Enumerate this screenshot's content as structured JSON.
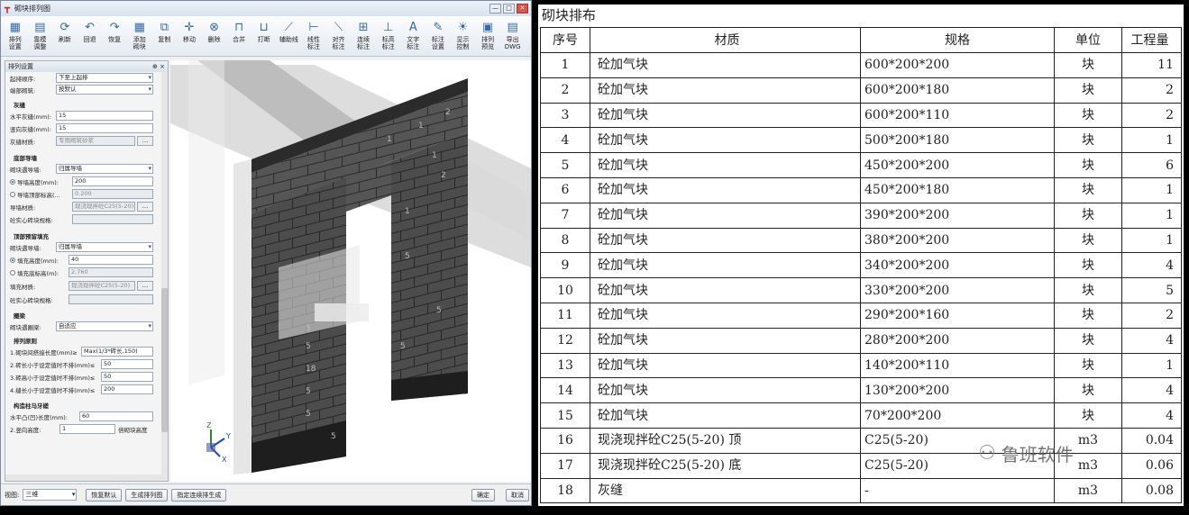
{
  "window": {
    "title": "砌块排列图",
    "minimize": "—",
    "maximize": "□",
    "close": "✕"
  },
  "toolbar": [
    {
      "label": "排列\n设置",
      "icon": "▦",
      "name": "arrange-settings"
    },
    {
      "label": "靠模\n调整",
      "icon": "▤",
      "name": "mold-adjust"
    },
    {
      "label": "刷新",
      "icon": "⟳",
      "name": "refresh"
    },
    {
      "label": "回退",
      "icon": "↶",
      "name": "undo"
    },
    {
      "label": "恢复",
      "icon": "↷",
      "name": "redo"
    },
    {
      "label": "添加\n砌块",
      "icon": "▦",
      "name": "add-block"
    },
    {
      "label": "复制",
      "icon": "⧉",
      "name": "copy"
    },
    {
      "label": "移动",
      "icon": "✛",
      "name": "move"
    },
    {
      "label": "删除",
      "icon": "⊗",
      "name": "delete"
    },
    {
      "label": "合并",
      "icon": "⊓",
      "name": "merge"
    },
    {
      "label": "打断",
      "icon": "⊔",
      "name": "break"
    },
    {
      "label": "辅助线",
      "icon": "⟋",
      "name": "guide-line"
    },
    {
      "label": "线性\n标注",
      "icon": "⊢",
      "name": "linear-dim"
    },
    {
      "label": "对齐\n标注",
      "icon": "⟍",
      "name": "align-dim"
    },
    {
      "label": "连续\n标注",
      "icon": "⊞",
      "name": "continuous-dim"
    },
    {
      "label": "标高\n标注",
      "icon": "⊥",
      "name": "elevation-dim"
    },
    {
      "label": "文字\n标注",
      "icon": "A",
      "name": "text-dim"
    },
    {
      "label": "标注\n设置",
      "icon": "✎",
      "name": "dim-settings"
    },
    {
      "label": "显示\n控制",
      "icon": "☀",
      "name": "display-control"
    },
    {
      "label": "排列\n预览",
      "icon": "▣",
      "name": "arrange-preview"
    },
    {
      "label": "导出\nDWG",
      "icon": "▤",
      "name": "export-dwg"
    }
  ],
  "panel": {
    "title": "排列设置",
    "pin": "⊕ ×",
    "r_start": {
      "label": "起排顺序:",
      "value": "下至上起排"
    },
    "r_end": {
      "label": "端部砌筑:",
      "value": "按默认"
    },
    "s_mortar": "灰缝",
    "r_h": {
      "label": "水平灰缝(mm):",
      "value": "15"
    },
    "r_v": {
      "label": "竖向灰缝(mm):",
      "value": "15"
    },
    "r_mat": {
      "label": "灰缝材质:",
      "value": "专用砌筑砂浆"
    },
    "s_bottom": "底部导墙",
    "r_b1": {
      "label": "砌块遇导墙:",
      "value": "归属导墙"
    },
    "r_b2": {
      "label": "导墙高度(mm):",
      "value": "200"
    },
    "r_b3": {
      "label": "导墙顶部标高(...",
      "value": "0.200"
    },
    "r_b4": {
      "label": "导墙材质:",
      "value": "现浇现拌砼C25(5-20)"
    },
    "r_b5": {
      "label": "砼实心砖块规格:",
      "value": ""
    },
    "s_top": "顶部预留填充",
    "r_t1": {
      "label": "砌块遇导墙:",
      "value": "归属导墙"
    },
    "r_t2": {
      "label": "填充高度(mm):",
      "value": "40"
    },
    "r_t3": {
      "label": "填充底标高(m):",
      "value": "2.760"
    },
    "r_t4": {
      "label": "填充材质:",
      "value": "现浇现拌砼C25(5-20)"
    },
    "r_t5": {
      "label": "砼实心砖块规格:",
      "value": ""
    },
    "s_ring": "圈梁",
    "r_ring": {
      "label": "砌块遇圈梁:",
      "value": "自适应"
    },
    "s_rule": "排列原则",
    "r_p1": {
      "label": "1.砌块间搭接长度(mm)≥",
      "value": "Max(1/3*砖长,150)"
    },
    "r_p2": {
      "label": "2.砖长小于设定值时不排(mm)≤",
      "value": "50"
    },
    "r_p3": {
      "label": "3.砖高小于设定值时不排(mm)≤",
      "value": "50"
    },
    "r_p4": {
      "label": "4.缝长小于设定值时不排(mm)≤",
      "value": "200"
    },
    "s_col": "构造柱马牙槎",
    "r_c1": {
      "label": "水平凸(凹)长度(mm):",
      "value": "60"
    },
    "r_c2": {
      "label": "2.竖向高度:",
      "value": "1",
      "suffix": "倍砌块高度"
    },
    "dots": "..."
  },
  "axes": {
    "z": "Z",
    "y": "Y",
    "x": "X"
  },
  "wall_labels": [
    "2",
    "1",
    "1",
    "1",
    "2",
    "1",
    "5",
    "5",
    "18",
    "5",
    "5",
    "5",
    "5",
    "5",
    "5"
  ],
  "bottom": {
    "view_label": "视图:",
    "view_value": "三维",
    "restore": "恢复默认",
    "generate": "生成排列图",
    "specify": "指定连续排生成",
    "ok": "确定",
    "cancel": "取消"
  },
  "doc": {
    "title": "砌块排布",
    "headers": [
      "序号",
      "材质",
      "规格",
      "单位",
      "工程量"
    ],
    "rows": [
      [
        "1",
        "砼加气块",
        "600*200*200",
        "块",
        "11"
      ],
      [
        "2",
        "砼加气块",
        "600*200*180",
        "块",
        "2"
      ],
      [
        "3",
        "砼加气块",
        "600*200*110",
        "块",
        "2"
      ],
      [
        "4",
        "砼加气块",
        "500*200*180",
        "块",
        "1"
      ],
      [
        "5",
        "砼加气块",
        "450*200*200",
        "块",
        "6"
      ],
      [
        "6",
        "砼加气块",
        "450*200*180",
        "块",
        "1"
      ],
      [
        "7",
        "砼加气块",
        "390*200*200",
        "块",
        "1"
      ],
      [
        "8",
        "砼加气块",
        "380*200*200",
        "块",
        "1"
      ],
      [
        "9",
        "砼加气块",
        "340*200*200",
        "块",
        "4"
      ],
      [
        "10",
        "砼加气块",
        "330*200*200",
        "块",
        "5"
      ],
      [
        "11",
        "砼加气块",
        "290*200*160",
        "块",
        "2"
      ],
      [
        "12",
        "砼加气块",
        "280*200*200",
        "块",
        "4"
      ],
      [
        "13",
        "砼加气块",
        "140*200*110",
        "块",
        "1"
      ],
      [
        "14",
        "砼加气块",
        "130*200*200",
        "块",
        "4"
      ],
      [
        "15",
        "砼加气块",
        "70*200*200",
        "块",
        "4"
      ],
      [
        "16",
        "现浇现拌砼C25(5-20) 顶",
        "C25(5-20)",
        "m3",
        "0.04"
      ],
      [
        "17",
        "现浇现拌砼C25(5-20) 底",
        "C25(5-20)",
        "m3",
        "0.06"
      ],
      [
        "18",
        "灰缝",
        "-",
        "m3",
        "0.08"
      ]
    ]
  },
  "watermark": "鲁班软件"
}
